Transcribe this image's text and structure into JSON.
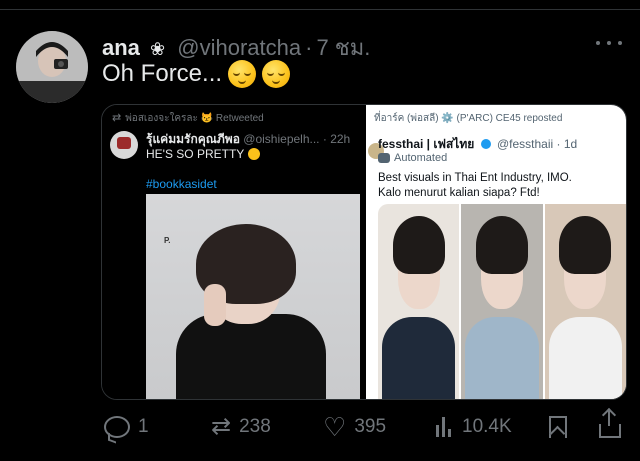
{
  "tweet": {
    "author_name": "ana",
    "name_symbol": "❀",
    "handle": "@vihoratcha",
    "time": "7 ชม.",
    "text": "Oh Force...",
    "emojis": [
      "relieved-face",
      "relieved-face"
    ]
  },
  "quoted_left": {
    "retweet_label": "พ่อสเองจะใครละ",
    "retweet_suffix": "Retweeted",
    "display_name": "รุ้แค่มมรักคุณภีพอ",
    "handle": "@oishiepelh...",
    "time": "22h",
    "text": "HE'S SO PRETTY",
    "hashtag": "#bookkasidet",
    "photo_letter": "P."
  },
  "quoted_right": {
    "repost_label": "ที่อาร์ค (พ่อสลี) ⚙️ (P'ARC) CE45 reposted",
    "display_name": "fessthai | เฟสไทย",
    "handle": "@fessthaii",
    "time": "1d",
    "automated_label": "Automated",
    "text_line1": "Best visuals in Thai Ent Industry, IMO.",
    "text_line2": "Kalo menurut kalian siapa? Ftd!"
  },
  "actions": {
    "replies": "1",
    "retweets": "238",
    "likes": "395",
    "views": "10.4K"
  },
  "colors": {
    "background": "#000000",
    "text": "#e7e9ea",
    "muted": "#71767b",
    "accent": "#1d9bf0"
  }
}
